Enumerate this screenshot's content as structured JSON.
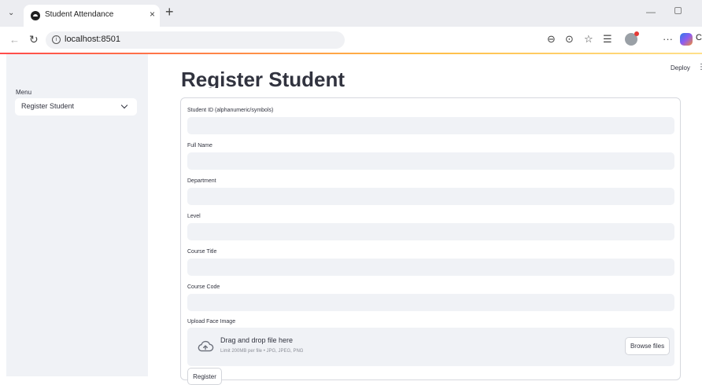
{
  "browser": {
    "tab_title": "Student Attendance",
    "tab_close": "×",
    "new_tab": "+",
    "url": "localhost:8501",
    "copilot_label": "Cl"
  },
  "icons": {
    "tab_list": "chevron-down-icon",
    "back": "arrow-left-icon",
    "reload": "reload-icon",
    "info": "info-icon",
    "zoom": "zoom-out-icon",
    "reader": "reader-icon",
    "favorite": "star-icon",
    "favorites": "favorites-icon",
    "more": "more-icon"
  },
  "sidebar": {
    "menu_label": "Menu",
    "selected": "Register Student"
  },
  "header": {
    "deploy": "Deploy",
    "menu": "⋮"
  },
  "main": {
    "title": "Register Student",
    "fields": [
      {
        "label": "Student ID (alphanumeric/symbols)",
        "value": ""
      },
      {
        "label": "Full Name",
        "value": ""
      },
      {
        "label": "Department",
        "value": ""
      },
      {
        "label": "Level",
        "value": ""
      },
      {
        "label": "Course Title",
        "value": ""
      },
      {
        "label": "Course Code",
        "value": ""
      }
    ],
    "upload": {
      "label": "Upload Face Image",
      "title": "Drag and drop file here",
      "subtitle": "Limit 200MB per file • JPG, JPEG, PNG",
      "browse": "Browse files"
    },
    "submit": "Register"
  },
  "colors": {
    "accent": "#ff4b4b",
    "sidebar_bg": "#f0f2f6",
    "text": "#31333f"
  }
}
